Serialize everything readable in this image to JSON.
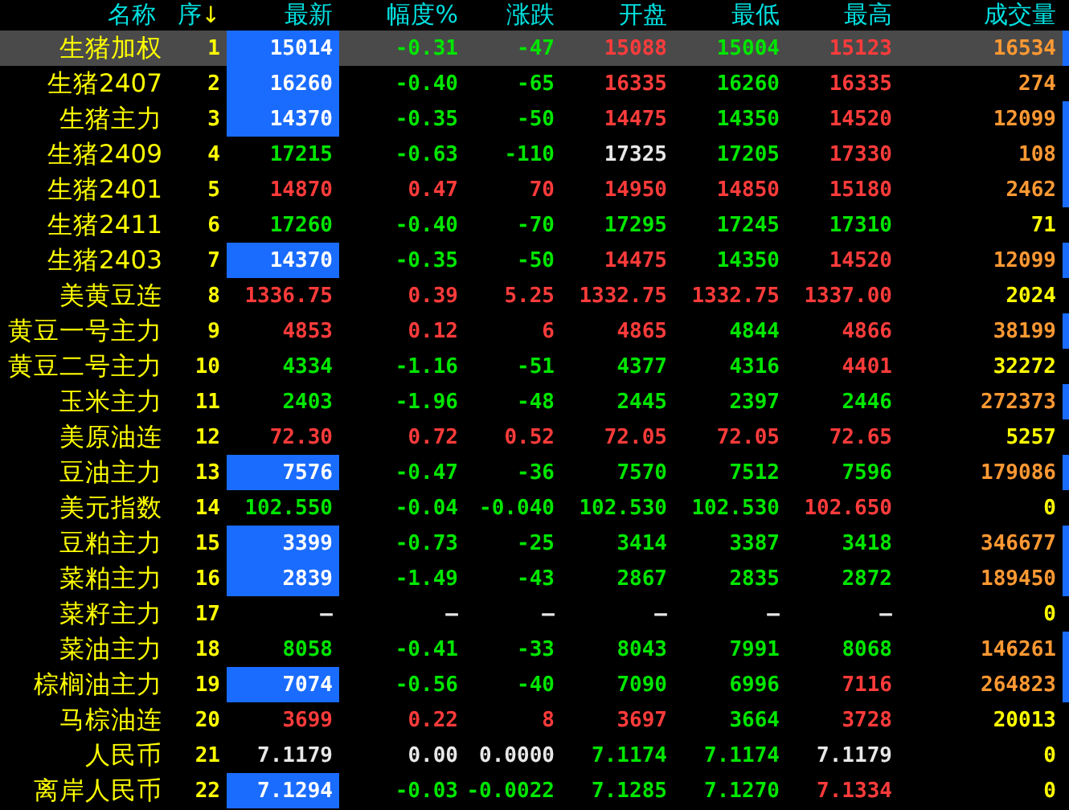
{
  "header": {
    "columns": [
      "名称",
      "序",
      "最新",
      "幅度%",
      "涨跌",
      "开盘",
      "最低",
      "最高",
      "成交量"
    ],
    "sort_arrow": "↓"
  },
  "rows": [
    {
      "name": "生猪加权",
      "seq": "1",
      "selected": true,
      "flash": true,
      "edge_mark": true,
      "cells": [
        {
          "text": "15014"
        },
        {
          "text": "-0.31",
          "kind": "down"
        },
        {
          "text": "-47",
          "kind": "down"
        },
        {
          "text": "15088",
          "kind": "up"
        },
        {
          "text": "15004",
          "kind": "down"
        },
        {
          "text": "15123",
          "kind": "up"
        }
      ],
      "volume": {
        "text": "16534",
        "kind": "orange"
      }
    },
    {
      "name": "生猪2407",
      "seq": "2",
      "selected": false,
      "flash": true,
      "edge_mark": false,
      "cells": [
        {
          "text": "16260"
        },
        {
          "text": "-0.40",
          "kind": "down"
        },
        {
          "text": "-65",
          "kind": "down"
        },
        {
          "text": "16335",
          "kind": "up"
        },
        {
          "text": "16260",
          "kind": "down"
        },
        {
          "text": "16335",
          "kind": "up"
        }
      ],
      "volume": {
        "text": "274",
        "kind": "orange"
      }
    },
    {
      "name": "生猪主力",
      "seq": "3",
      "selected": false,
      "flash": true,
      "edge_mark": true,
      "cells": [
        {
          "text": "14370"
        },
        {
          "text": "-0.35",
          "kind": "down"
        },
        {
          "text": "-50",
          "kind": "down"
        },
        {
          "text": "14475",
          "kind": "up"
        },
        {
          "text": "14350",
          "kind": "down"
        },
        {
          "text": "14520",
          "kind": "up"
        }
      ],
      "volume": {
        "text": "12099",
        "kind": "orange"
      }
    },
    {
      "name": "生猪2409",
      "seq": "4",
      "selected": false,
      "flash": false,
      "edge_mark": true,
      "cells": [
        {
          "text": "17215",
          "kind": "down"
        },
        {
          "text": "-0.63",
          "kind": "down"
        },
        {
          "text": "-110",
          "kind": "down"
        },
        {
          "text": "17325",
          "kind": "flat"
        },
        {
          "text": "17205",
          "kind": "down"
        },
        {
          "text": "17330",
          "kind": "up"
        }
      ],
      "volume": {
        "text": "108",
        "kind": "orange"
      }
    },
    {
      "name": "生猪2401",
      "seq": "5",
      "selected": false,
      "flash": false,
      "edge_mark": true,
      "cells": [
        {
          "text": "14870",
          "kind": "up"
        },
        {
          "text": "0.47",
          "kind": "up"
        },
        {
          "text": "70",
          "kind": "up"
        },
        {
          "text": "14950",
          "kind": "up"
        },
        {
          "text": "14850",
          "kind": "up"
        },
        {
          "text": "15180",
          "kind": "up"
        }
      ],
      "volume": {
        "text": "2462",
        "kind": "orange"
      }
    },
    {
      "name": "生猪2411",
      "seq": "6",
      "selected": false,
      "flash": false,
      "edge_mark": false,
      "cells": [
        {
          "text": "17260",
          "kind": "down"
        },
        {
          "text": "-0.40",
          "kind": "down"
        },
        {
          "text": "-70",
          "kind": "down"
        },
        {
          "text": "17295",
          "kind": "down"
        },
        {
          "text": "17245",
          "kind": "down"
        },
        {
          "text": "17310",
          "kind": "down"
        }
      ],
      "volume": {
        "text": "71",
        "kind": "yellow"
      }
    },
    {
      "name": "生猪2403",
      "seq": "7",
      "selected": false,
      "flash": true,
      "edge_mark": true,
      "cells": [
        {
          "text": "14370"
        },
        {
          "text": "-0.35",
          "kind": "down"
        },
        {
          "text": "-50",
          "kind": "down"
        },
        {
          "text": "14475",
          "kind": "up"
        },
        {
          "text": "14350",
          "kind": "down"
        },
        {
          "text": "14520",
          "kind": "up"
        }
      ],
      "volume": {
        "text": "12099",
        "kind": "orange"
      }
    },
    {
      "name": "美黄豆连",
      "seq": "8",
      "selected": false,
      "flash": false,
      "edge_mark": false,
      "cells": [
        {
          "text": "1336.75",
          "kind": "up"
        },
        {
          "text": "0.39",
          "kind": "up"
        },
        {
          "text": "5.25",
          "kind": "up"
        },
        {
          "text": "1332.75",
          "kind": "up"
        },
        {
          "text": "1332.75",
          "kind": "up"
        },
        {
          "text": "1337.00",
          "kind": "up"
        }
      ],
      "volume": {
        "text": "2024",
        "kind": "yellow"
      }
    },
    {
      "name": "黄豆一号主力",
      "seq": "9",
      "selected": false,
      "flash": false,
      "edge_mark": true,
      "cells": [
        {
          "text": "4853",
          "kind": "up"
        },
        {
          "text": "0.12",
          "kind": "up"
        },
        {
          "text": "6",
          "kind": "up"
        },
        {
          "text": "4865",
          "kind": "up"
        },
        {
          "text": "4844",
          "kind": "down"
        },
        {
          "text": "4866",
          "kind": "up"
        }
      ],
      "volume": {
        "text": "38199",
        "kind": "orange"
      }
    },
    {
      "name": "黄豆二号主力",
      "seq": "10",
      "selected": false,
      "flash": false,
      "edge_mark": false,
      "cells": [
        {
          "text": "4334",
          "kind": "down"
        },
        {
          "text": "-1.16",
          "kind": "down"
        },
        {
          "text": "-51",
          "kind": "down"
        },
        {
          "text": "4377",
          "kind": "down"
        },
        {
          "text": "4316",
          "kind": "down"
        },
        {
          "text": "4401",
          "kind": "up"
        }
      ],
      "volume": {
        "text": "32272",
        "kind": "yellow"
      }
    },
    {
      "name": "玉米主力",
      "seq": "11",
      "selected": false,
      "flash": false,
      "edge_mark": true,
      "cells": [
        {
          "text": "2403",
          "kind": "down"
        },
        {
          "text": "-1.96",
          "kind": "down"
        },
        {
          "text": "-48",
          "kind": "down"
        },
        {
          "text": "2445",
          "kind": "down"
        },
        {
          "text": "2397",
          "kind": "down"
        },
        {
          "text": "2446",
          "kind": "down"
        }
      ],
      "volume": {
        "text": "272373",
        "kind": "orange"
      }
    },
    {
      "name": "美原油连",
      "seq": "12",
      "selected": false,
      "flash": false,
      "edge_mark": false,
      "cells": [
        {
          "text": "72.30",
          "kind": "up"
        },
        {
          "text": "0.72",
          "kind": "up"
        },
        {
          "text": "0.52",
          "kind": "up"
        },
        {
          "text": "72.05",
          "kind": "up"
        },
        {
          "text": "72.05",
          "kind": "up"
        },
        {
          "text": "72.65",
          "kind": "up"
        }
      ],
      "volume": {
        "text": "5257",
        "kind": "yellow"
      }
    },
    {
      "name": "豆油主力",
      "seq": "13",
      "selected": false,
      "flash": true,
      "edge_mark": true,
      "cells": [
        {
          "text": "7576"
        },
        {
          "text": "-0.47",
          "kind": "down"
        },
        {
          "text": "-36",
          "kind": "down"
        },
        {
          "text": "7570",
          "kind": "down"
        },
        {
          "text": "7512",
          "kind": "down"
        },
        {
          "text": "7596",
          "kind": "down"
        }
      ],
      "volume": {
        "text": "179086",
        "kind": "orange"
      }
    },
    {
      "name": "美元指数",
      "seq": "14",
      "selected": false,
      "flash": false,
      "edge_mark": false,
      "cells": [
        {
          "text": "102.550",
          "kind": "down"
        },
        {
          "text": "-0.04",
          "kind": "down"
        },
        {
          "text": "-0.040",
          "kind": "down"
        },
        {
          "text": "102.530",
          "kind": "down"
        },
        {
          "text": "102.530",
          "kind": "down"
        },
        {
          "text": "102.650",
          "kind": "up"
        }
      ],
      "volume": {
        "text": "0",
        "kind": "yellow"
      }
    },
    {
      "name": "豆粕主力",
      "seq": "15",
      "selected": false,
      "flash": true,
      "edge_mark": true,
      "cells": [
        {
          "text": "3399"
        },
        {
          "text": "-0.73",
          "kind": "down"
        },
        {
          "text": "-25",
          "kind": "down"
        },
        {
          "text": "3414",
          "kind": "down"
        },
        {
          "text": "3387",
          "kind": "down"
        },
        {
          "text": "3418",
          "kind": "down"
        }
      ],
      "volume": {
        "text": "346677",
        "kind": "orange"
      }
    },
    {
      "name": "菜粕主力",
      "seq": "16",
      "selected": false,
      "flash": true,
      "edge_mark": true,
      "cells": [
        {
          "text": "2839"
        },
        {
          "text": "-1.49",
          "kind": "down"
        },
        {
          "text": "-43",
          "kind": "down"
        },
        {
          "text": "2867",
          "kind": "down"
        },
        {
          "text": "2835",
          "kind": "down"
        },
        {
          "text": "2872",
          "kind": "down"
        }
      ],
      "volume": {
        "text": "189450",
        "kind": "orange"
      }
    },
    {
      "name": "菜籽主力",
      "seq": "17",
      "selected": false,
      "flash": false,
      "edge_mark": false,
      "cells": [
        {
          "text": "—",
          "kind": "flat"
        },
        {
          "text": "—",
          "kind": "flat"
        },
        {
          "text": "—",
          "kind": "flat"
        },
        {
          "text": "—",
          "kind": "flat"
        },
        {
          "text": "—",
          "kind": "flat"
        },
        {
          "text": "—",
          "kind": "flat"
        }
      ],
      "volume": {
        "text": "0",
        "kind": "yellow"
      }
    },
    {
      "name": "菜油主力",
      "seq": "18",
      "selected": false,
      "flash": false,
      "edge_mark": true,
      "cells": [
        {
          "text": "8058",
          "kind": "down"
        },
        {
          "text": "-0.41",
          "kind": "down"
        },
        {
          "text": "-33",
          "kind": "down"
        },
        {
          "text": "8043",
          "kind": "down"
        },
        {
          "text": "7991",
          "kind": "down"
        },
        {
          "text": "8068",
          "kind": "down"
        }
      ],
      "volume": {
        "text": "146261",
        "kind": "orange"
      }
    },
    {
      "name": "棕榈油主力",
      "seq": "19",
      "selected": false,
      "flash": true,
      "edge_mark": true,
      "cells": [
        {
          "text": "7074"
        },
        {
          "text": "-0.56",
          "kind": "down"
        },
        {
          "text": "-40",
          "kind": "down"
        },
        {
          "text": "7090",
          "kind": "down"
        },
        {
          "text": "6996",
          "kind": "down"
        },
        {
          "text": "7116",
          "kind": "up"
        }
      ],
      "volume": {
        "text": "264823",
        "kind": "orange"
      }
    },
    {
      "name": "马棕油连",
      "seq": "20",
      "selected": false,
      "flash": false,
      "edge_mark": false,
      "cells": [
        {
          "text": "3699",
          "kind": "up"
        },
        {
          "text": "0.22",
          "kind": "up"
        },
        {
          "text": "8",
          "kind": "up"
        },
        {
          "text": "3697",
          "kind": "up"
        },
        {
          "text": "3664",
          "kind": "down"
        },
        {
          "text": "3728",
          "kind": "up"
        }
      ],
      "volume": {
        "text": "20013",
        "kind": "yellow"
      }
    },
    {
      "name": "人民币",
      "seq": "21",
      "selected": false,
      "flash": false,
      "edge_mark": false,
      "cells": [
        {
          "text": "7.1179",
          "kind": "flat"
        },
        {
          "text": "0.00",
          "kind": "flat"
        },
        {
          "text": "0.0000",
          "kind": "flat"
        },
        {
          "text": "7.1174",
          "kind": "down"
        },
        {
          "text": "7.1174",
          "kind": "down"
        },
        {
          "text": "7.1179",
          "kind": "flat"
        }
      ],
      "volume": {
        "text": "0",
        "kind": "yellow"
      }
    },
    {
      "name": "离岸人民币",
      "seq": "22",
      "selected": false,
      "flash": true,
      "edge_mark": false,
      "cells": [
        {
          "text": "7.1294"
        },
        {
          "text": "-0.03",
          "kind": "down"
        },
        {
          "text": "-0.0022",
          "kind": "down"
        },
        {
          "text": "7.1285",
          "kind": "down"
        },
        {
          "text": "7.1270",
          "kind": "down"
        },
        {
          "text": "7.1334",
          "kind": "up"
        }
      ],
      "volume": {
        "text": "0",
        "kind": "yellow"
      }
    }
  ]
}
